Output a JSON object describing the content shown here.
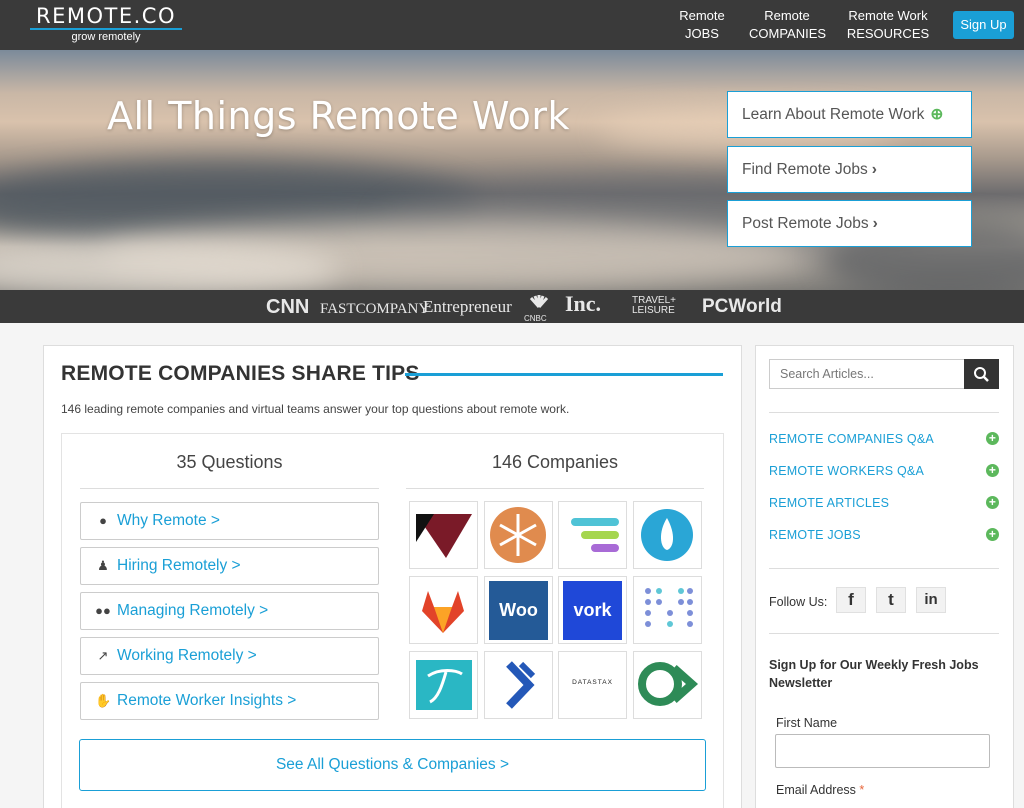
{
  "header": {
    "logo_brand": "REMOTE.CO",
    "logo_tagline": "grow remotely",
    "nav": [
      {
        "line1": "Remote",
        "line2": "JOBS"
      },
      {
        "line1": "Remote",
        "line2": "COMPANIES"
      },
      {
        "line1": "Remote Work",
        "line2": "RESOURCES"
      }
    ],
    "signup_label": "Sign Up"
  },
  "hero": {
    "title": "All Things Remote Work",
    "buttons": [
      "Learn About Remote Work",
      "Find Remote Jobs",
      "Post Remote Jobs"
    ]
  },
  "press": [
    "CNN",
    "FASTCOMPANY",
    "Entrepreneur",
    "CNBC",
    "Inc.",
    "TRAVEL+ LEISURE",
    "PCWorld"
  ],
  "main": {
    "title": "REMOTE COMPANIES SHARE TIPS",
    "subtitle": "146 leading remote companies and virtual teams answer your top questions about remote work.",
    "questions_heading": "35 Questions",
    "companies_heading": "146 Companies",
    "questions": [
      {
        "label": "Why Remote >",
        "icon": "info-icon"
      },
      {
        "label": "Hiring Remotely >",
        "icon": "person-icon"
      },
      {
        "label": "Managing Remotely >",
        "icon": "group-icon"
      },
      {
        "label": "Working Remotely >",
        "icon": "chart-icon"
      },
      {
        "label": "Remote Worker Insights >",
        "icon": "thumbs-up-icon"
      }
    ],
    "logos": [
      "",
      "",
      "",
      "",
      "",
      "Woo",
      "vork",
      "",
      "",
      "",
      "DATASTAX",
      ""
    ],
    "see_all": "See All Questions & Companies >"
  },
  "sidebar": {
    "search_placeholder": "Search Articles...",
    "links": [
      "REMOTE COMPANIES Q&A",
      "REMOTE WORKERS Q&A",
      "REMOTE ARTICLES",
      "REMOTE JOBS"
    ],
    "follow_label": "Follow Us:",
    "social": [
      "f",
      "t",
      "in"
    ],
    "newsletter_title": "Sign Up for Our Weekly Fresh Jobs Newsletter",
    "first_name_label": "First Name",
    "email_label": "Email Address",
    "email_required": "*"
  }
}
